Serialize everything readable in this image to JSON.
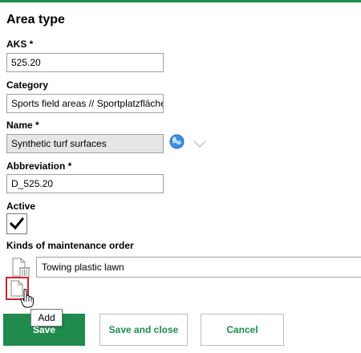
{
  "form": {
    "title": "Area type",
    "aks": {
      "label": "AKS *",
      "value": "525.20"
    },
    "category": {
      "label": "Category",
      "value": "Sports field areas // Sportplatzfläche"
    },
    "name": {
      "label": "Name *",
      "value": "Synthetic turf surfaces"
    },
    "abbreviation": {
      "label": "Abbreviation *",
      "value": "D_525.20"
    },
    "active": {
      "label": "Active",
      "checked": true
    },
    "maintenance": {
      "label": "Kinds of maintenance order",
      "items": [
        {
          "value": "Towing plastic lawn"
        }
      ],
      "add_tooltip": "Add"
    }
  },
  "buttons": {
    "save": "Save",
    "save_close": "Save and close",
    "cancel": "Cancel"
  },
  "colors": {
    "accent": "#1f8b4c",
    "highlight": "#d0202a",
    "readonly_bg": "#e6e6e6"
  },
  "icons": [
    "globe-icon",
    "chevron-down-icon",
    "checkmark-icon",
    "document-delete-icon",
    "document-add-icon",
    "hand-cursor-icon"
  ]
}
